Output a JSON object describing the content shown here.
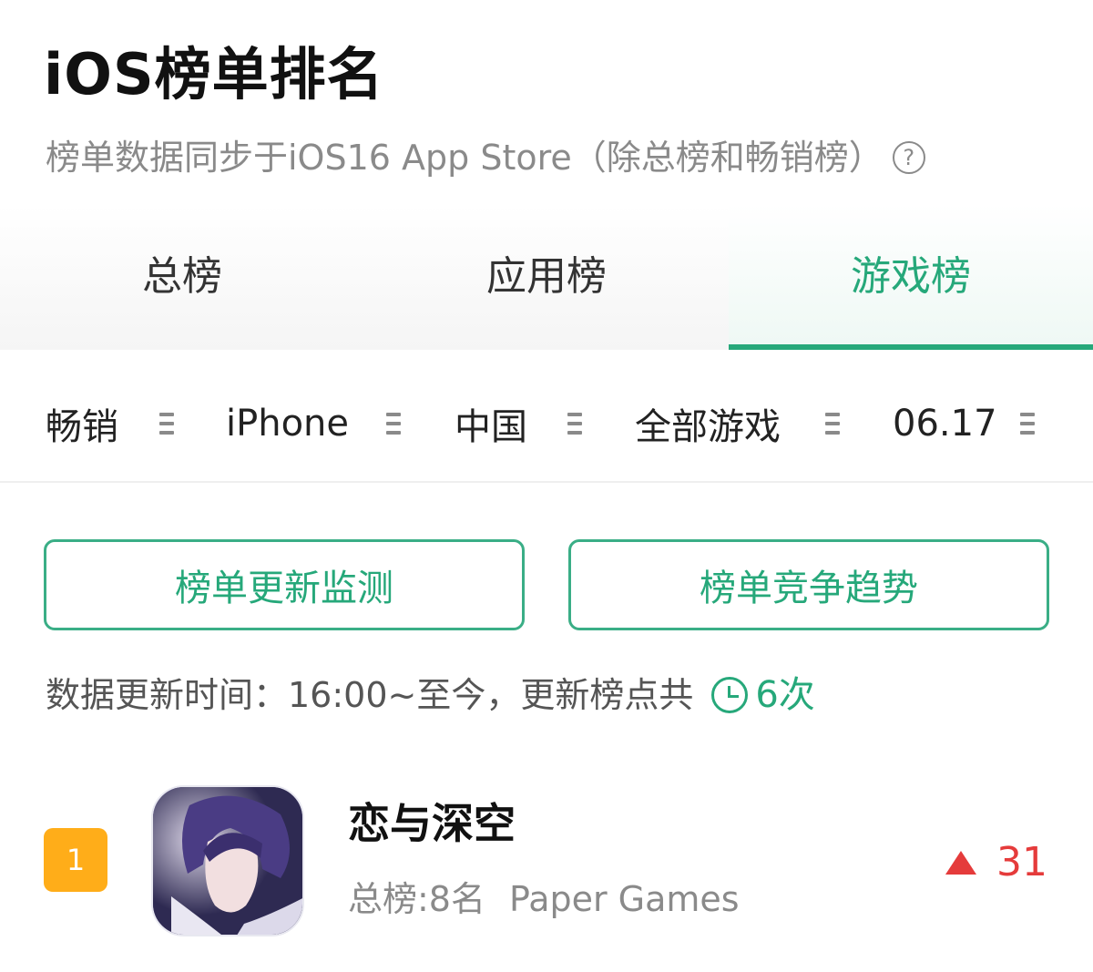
{
  "header": {
    "title": "iOS榜单排名",
    "subtitle": "榜单数据同步于iOS16 App Store（除总榜和畅销榜）",
    "help_icon": "?"
  },
  "tabs": [
    {
      "label": "总榜",
      "active": false
    },
    {
      "label": "应用榜",
      "active": false
    },
    {
      "label": "游戏榜",
      "active": true
    }
  ],
  "filters": {
    "list_type": "畅销",
    "device": "iPhone",
    "region": "中国",
    "category": "全部游戏",
    "date": "06.17"
  },
  "actions": {
    "monitor_label": "榜单更新监测",
    "trend_label": "榜单竞争趋势"
  },
  "update_info": {
    "text": "数据更新时间：16:00~至今，更新榜点共",
    "count": "6次"
  },
  "apps": [
    {
      "rank": "1",
      "name": "恋与深空",
      "overall_rank": "总榜:8名",
      "developer": "Paper Games",
      "change": "31",
      "change_direction": "up"
    }
  ],
  "colors": {
    "accent": "#26a87a",
    "rank_badge": "#ffad19",
    "rank_up": "#e53b3b",
    "muted_text": "#8a8a8a"
  }
}
